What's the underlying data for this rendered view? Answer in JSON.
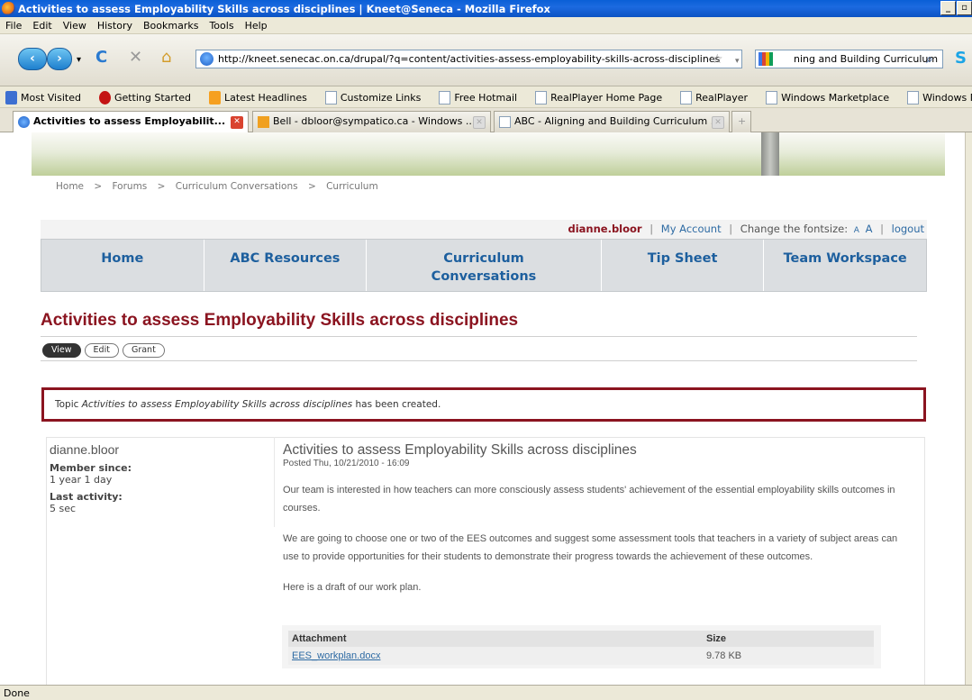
{
  "window": {
    "title": "Activities to assess Employability Skills across disciplines | Kneet@Seneca - Mozilla Firefox"
  },
  "menu": [
    "File",
    "Edit",
    "View",
    "History",
    "Bookmarks",
    "Tools",
    "Help"
  ],
  "url": "http://kneet.senecac.on.ca/drupal/?q=content/activities-assess-employability-skills-across-disciplines",
  "search_text": "ning and Building Curriculum",
  "bookmarks": [
    "Most Visited",
    "Getting Started",
    "Latest Headlines",
    "Customize Links",
    "Free Hotmail",
    "RealPlayer Home Page",
    "RealPlayer",
    "Windows Marketplace",
    "Windows Media"
  ],
  "tabs": [
    {
      "label": "Activities to assess Employabilit..."
    },
    {
      "label": "Bell - dbloor@sympatico.ca - Windows ..."
    },
    {
      "label": "ABC - Aligning and Building Curriculum ..."
    }
  ],
  "breadcrumb": [
    "Home",
    "Forums",
    "Curriculum Conversations",
    "Curriculum"
  ],
  "breadcrumb_sep": ">",
  "userbar": {
    "username": "dianne.bloor",
    "my_account": "My Account",
    "fontsize_label": "Change the fontsize:",
    "font_small": "A",
    "font_large": "A",
    "logout": "logout",
    "sep": "|"
  },
  "mainnav": [
    {
      "label": "Home"
    },
    {
      "label": "ABC Resources"
    },
    {
      "label": "Curriculum Conversations"
    },
    {
      "label": "Tip Sheet"
    },
    {
      "label": "Team Workspace"
    }
  ],
  "page_title": "Activities to assess Employability Skills across disciplines",
  "page_tabs": [
    "View",
    "Edit",
    "Grant"
  ],
  "message": {
    "prefix": "Topic ",
    "topic": "Activities to assess Employability Skills across disciplines",
    "suffix": " has been created."
  },
  "author": {
    "name": "dianne.bloor",
    "member_since_label": "Member since:",
    "member_since": "1 year 1 day",
    "last_activity_label": "Last activity:",
    "last_activity": "5 sec"
  },
  "post": {
    "title": "Activities to assess Employability Skills across disciplines",
    "posted": "Posted Thu, 10/21/2010 - 16:09",
    "paragraphs": [
      "Our team is interested in how teachers can more consciously assess students' achievement of the essential employability skills outcomes in courses.",
      "We are going to choose one or two of the EES outcomes and suggest some assessment tools that teachers in a variety of subject areas can use to provide opportunities for their students to demonstrate their progress towards the achievement of these outcomes.",
      "Here is a draft of our work plan."
    ]
  },
  "attachments": {
    "headers": [
      "Attachment",
      "Size"
    ],
    "rows": [
      [
        "EES_workplan.docx",
        "9.78 KB"
      ]
    ]
  },
  "status": "Done"
}
